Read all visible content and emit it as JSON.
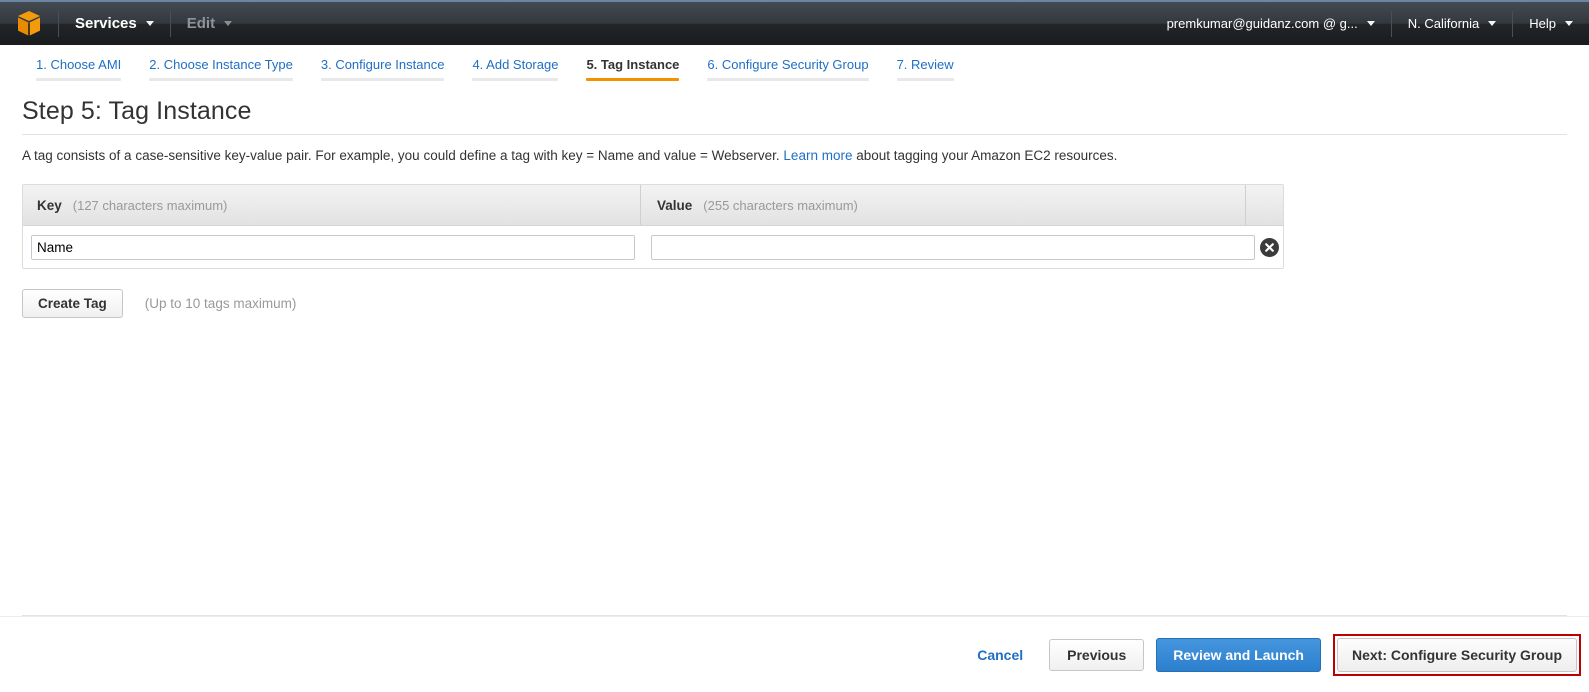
{
  "topbar": {
    "logo_icon": "aws-cube-icon",
    "services_label": "Services",
    "edit_label": "Edit",
    "account_label": "premkumar@guidanz.com @ g...",
    "region_label": "N. California",
    "help_label": "Help",
    "accent_orange": "#f49b0b",
    "bar_dark": "#232629"
  },
  "steps": [
    {
      "label": "1. Choose AMI",
      "active": false
    },
    {
      "label": "2. Choose Instance Type",
      "active": false
    },
    {
      "label": "3. Configure Instance",
      "active": false
    },
    {
      "label": "4. Add Storage",
      "active": false
    },
    {
      "label": "5. Tag Instance",
      "active": true
    },
    {
      "label": "6. Configure Security Group",
      "active": false
    },
    {
      "label": "7. Review",
      "active": false
    }
  ],
  "page": {
    "title": "Step 5: Tag Instance",
    "desc_before": "A tag consists of a case-sensitive key-value pair. For example, you could define a tag with key = Name and value = Webserver.",
    "learn_more": "Learn more",
    "desc_after": "about tagging your Amazon EC2 resources."
  },
  "tag_table": {
    "key_header": "Key",
    "key_hint": "(127 characters maximum)",
    "value_header": "Value",
    "value_hint": "(255 characters maximum)",
    "rows": [
      {
        "key_value": "Name",
        "key_placeholder": "",
        "value_value": "",
        "value_placeholder": "",
        "remove_icon": "close-circle-icon"
      }
    ]
  },
  "create": {
    "button_label": "Create Tag",
    "hint": "(Up to 10 tags maximum)"
  },
  "footer": {
    "cancel_label": "Cancel",
    "previous_label": "Previous",
    "review_label": "Review and Launch",
    "next_label": "Next: Configure Security Group",
    "primary_blue": "#2c7fcd",
    "highlight_red": "#c00000"
  }
}
